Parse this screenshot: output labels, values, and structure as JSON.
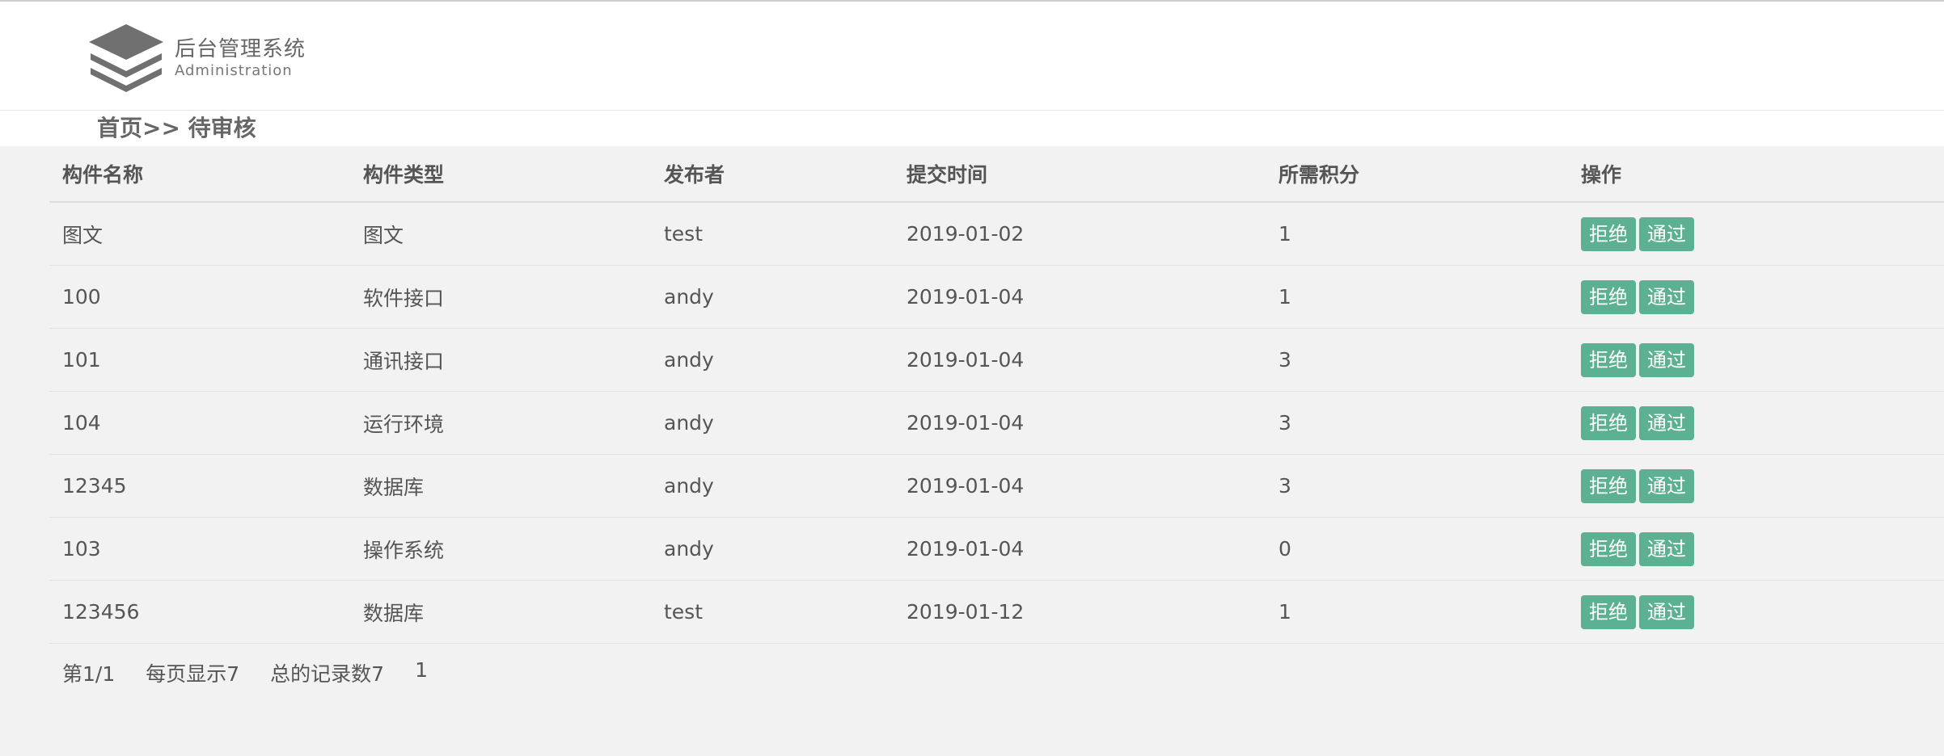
{
  "header": {
    "logo_title": "后台管理系统",
    "logo_subtitle": "Administration"
  },
  "breadcrumb": "首页>> 待审核",
  "table": {
    "columns": [
      "构件名称",
      "构件类型",
      "发布者",
      "提交时间",
      "所需积分",
      "操作"
    ],
    "rows": [
      {
        "name": "图文",
        "type": "图文",
        "publisher": "test",
        "time": "2019-01-02",
        "points": "1"
      },
      {
        "name": "100",
        "type": "软件接口",
        "publisher": "andy",
        "time": "2019-01-04",
        "points": "1"
      },
      {
        "name": "101",
        "type": "通讯接口",
        "publisher": "andy",
        "time": "2019-01-04",
        "points": "3"
      },
      {
        "name": "104",
        "type": "运行环境",
        "publisher": "andy",
        "time": "2019-01-04",
        "points": "3"
      },
      {
        "name": "12345",
        "type": "数据库",
        "publisher": "andy",
        "time": "2019-01-04",
        "points": "3"
      },
      {
        "name": "103",
        "type": "操作系统",
        "publisher": "andy",
        "time": "2019-01-04",
        "points": "0"
      },
      {
        "name": "123456",
        "type": "数据库",
        "publisher": "test",
        "time": "2019-01-12",
        "points": "1"
      }
    ],
    "reject_label": "拒绝",
    "approve_label": "通过"
  },
  "pager": {
    "page": "第1/1",
    "per_page": "每页显示7",
    "total": "总的记录数7",
    "page_link": "1"
  },
  "colors": {
    "button": "#5cb192",
    "background": "#f2f2f2"
  },
  "icons": {
    "logo": "stacked-layers-icon"
  }
}
